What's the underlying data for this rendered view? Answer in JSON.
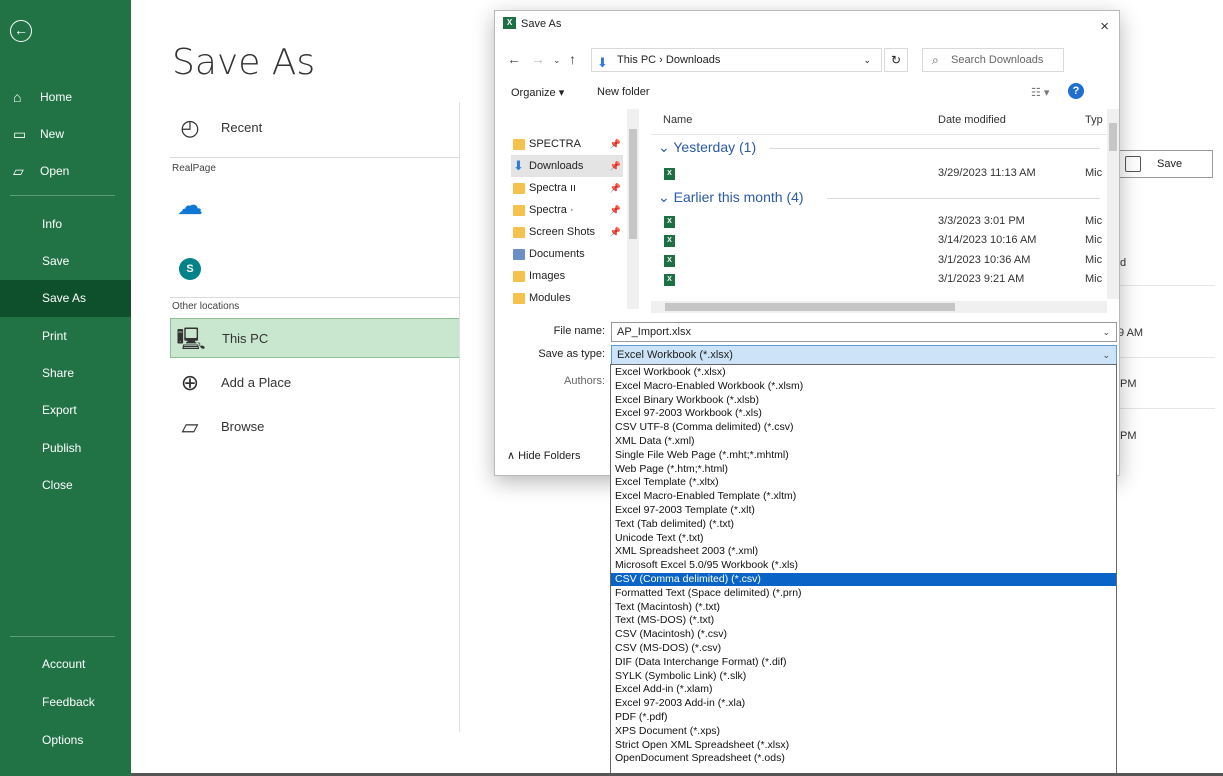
{
  "nav": {
    "back_glyph": "←",
    "items": [
      {
        "label": "Home"
      },
      {
        "label": "New"
      },
      {
        "label": "Open"
      },
      {
        "label": "Info"
      },
      {
        "label": "Save"
      },
      {
        "label": "Save As",
        "active": true
      },
      {
        "label": "Print"
      },
      {
        "label": "Share"
      },
      {
        "label": "Export"
      },
      {
        "label": "Publish"
      },
      {
        "label": "Close"
      },
      {
        "label": "Account"
      },
      {
        "label": "Feedback"
      },
      {
        "label": "Options"
      }
    ]
  },
  "pane": {
    "title": "Save As",
    "recent": "Recent",
    "section_realpage": "RealPage",
    "section_other": "Other locations",
    "this_pc": "This PC",
    "add_place": "Add a Place",
    "browse": "Browse"
  },
  "background": {
    "save_label": "Save",
    "text_d": "d",
    "text_9am": "9 AM",
    "text_pm1": "PM",
    "text_pm2": "PM"
  },
  "dialog": {
    "title": "Save As",
    "close": "×",
    "address": "This PC  ›  Downloads",
    "search_placeholder": "Search Downloads",
    "organize": "Organize ▾",
    "new_folder": "New folder",
    "nav_folders": [
      {
        "label": "SPECTRA"
      },
      {
        "label": "Downloads"
      },
      {
        "label": "Spectra     ıı"
      },
      {
        "label": "Spectra     ·"
      },
      {
        "label": "Screen Shots"
      },
      {
        "label": "Documents"
      },
      {
        "label": "Images"
      },
      {
        "label": "Modules"
      }
    ],
    "columns": {
      "name": "Name",
      "date": "Date modified",
      "type": "Typ"
    },
    "groups": [
      {
        "label": "Yesterday (1)"
      },
      {
        "label": "Earlier this month (4)"
      }
    ],
    "files": [
      {
        "date": "3/29/2023 11:13 AM",
        "type": "Mic"
      },
      {
        "date": "3/3/2023 3:01 PM",
        "type": "Mic"
      },
      {
        "date": "3/14/2023 10:16 AM",
        "type": "Mic"
      },
      {
        "date": "3/1/2023 10:36 AM",
        "type": "Mic"
      },
      {
        "date": "3/1/2023 9:21 AM",
        "type": "Mic"
      }
    ],
    "file_name_label": "File name:",
    "file_name_value": "AP_Import.xlsx",
    "save_type_label": "Save as type:",
    "save_type_value": "Excel Workbook (*.xlsx)",
    "authors_label": "Authors:",
    "hide_folders": "Hide Folders"
  },
  "dropdown": {
    "options": [
      {
        "label": "Excel Workbook (*.xlsx)"
      },
      {
        "label": "Excel Macro-Enabled Workbook (*.xlsm)"
      },
      {
        "label": "Excel Binary Workbook (*.xlsb)"
      },
      {
        "label": "Excel 97-2003 Workbook (*.xls)"
      },
      {
        "label": "CSV UTF-8 (Comma delimited) (*.csv)"
      },
      {
        "label": "XML Data (*.xml)"
      },
      {
        "label": "Single File Web Page (*.mht;*.mhtml)"
      },
      {
        "label": "Web Page (*.htm;*.html)"
      },
      {
        "label": "Excel Template (*.xltx)"
      },
      {
        "label": "Excel Macro-Enabled Template (*.xltm)"
      },
      {
        "label": "Excel 97-2003 Template (*.xlt)"
      },
      {
        "label": "Text (Tab delimited) (*.txt)"
      },
      {
        "label": "Unicode Text (*.txt)"
      },
      {
        "label": "XML Spreadsheet 2003 (*.xml)"
      },
      {
        "label": "Microsoft Excel 5.0/95 Workbook (*.xls)"
      },
      {
        "label": "CSV (Comma delimited) (*.csv)",
        "highlighted": true
      },
      {
        "label": "Formatted Text (Space delimited) (*.prn)"
      },
      {
        "label": "Text (Macintosh) (*.txt)"
      },
      {
        "label": "Text (MS-DOS) (*.txt)"
      },
      {
        "label": "CSV (Macintosh) (*.csv)"
      },
      {
        "label": "CSV (MS-DOS) (*.csv)"
      },
      {
        "label": "DIF (Data Interchange Format) (*.dif)"
      },
      {
        "label": "SYLK (Symbolic Link) (*.slk)"
      },
      {
        "label": "Excel Add-in (*.xlam)"
      },
      {
        "label": "Excel 97-2003 Add-in (*.xla)"
      },
      {
        "label": "PDF (*.pdf)"
      },
      {
        "label": "XPS Document (*.xps)"
      },
      {
        "label": "Strict Open XML Spreadsheet (*.xlsx)"
      },
      {
        "label": "OpenDocument Spreadsheet (*.ods)"
      }
    ]
  },
  "colors": {
    "nav_green": "#217346",
    "nav_active": "#0e4f2c",
    "highlight": "#0a64c8"
  }
}
